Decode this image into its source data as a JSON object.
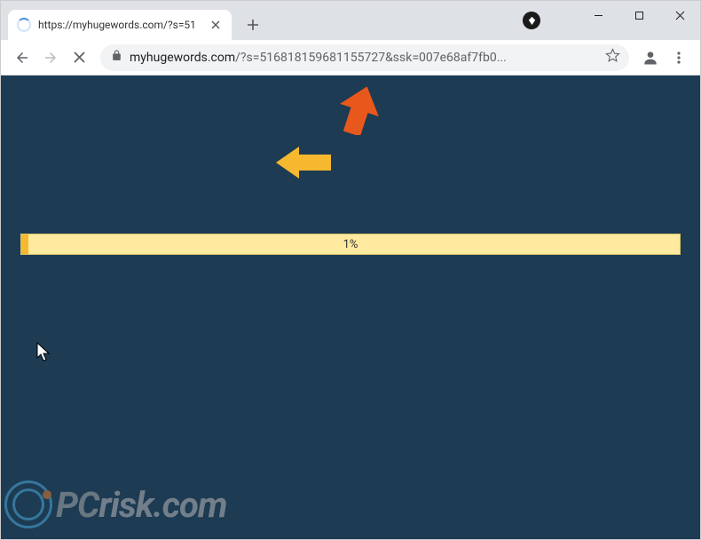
{
  "titlebar": {
    "tab_title": "https://myhugewords.com/?s=51"
  },
  "toolbar": {
    "url_domain": "myhugewords.com",
    "url_path": "/?s=516818159681155727&ssk=007e68af7fb0..."
  },
  "page": {
    "progress_text": "1%",
    "progress_value": 1
  },
  "watermark": {
    "text_pc": "PC",
    "text_rest": "risk.com"
  }
}
